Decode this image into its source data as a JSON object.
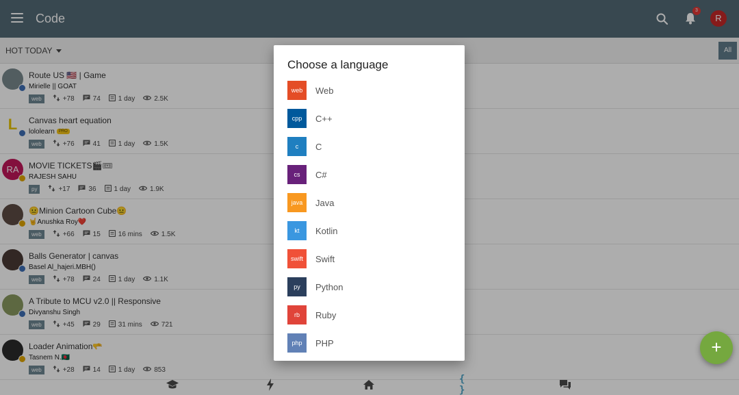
{
  "appbar": {
    "title": "Code",
    "notification_count": "3",
    "avatar_letter": "R"
  },
  "filter": {
    "sort_label": "HOT TODAY",
    "all_label": "All"
  },
  "codes": [
    {
      "title": "Route US 🇺🇸 | Game",
      "author": "Mirielle || GOAT",
      "lang": "web",
      "votes": "+78",
      "comments": "74",
      "time": "1 day",
      "views": "2.5K",
      "avatar_text": "",
      "avatar_color": "#7a8a8e",
      "level_color": "#3f6fb5",
      "pro": ""
    },
    {
      "title": "Canvas heart equation",
      "author": "lololearn",
      "lang": "web",
      "votes": "+76",
      "comments": "41",
      "time": "1 day",
      "views": "1.5K",
      "avatar_text": "L",
      "avatar_color": "#ffffff",
      "level_color": "#3f6fb5",
      "pro": "PRO"
    },
    {
      "title": "MOVIE TICKETS🎬🎟",
      "author": "RAJESH SAHU",
      "lang": "py",
      "votes": "+17",
      "comments": "36",
      "time": "1 day",
      "views": "1.9K",
      "avatar_text": "RA",
      "avatar_color": "#c2185b",
      "level_color": "#e0a500",
      "pro": ""
    },
    {
      "title": "😐Minion Cartoon Cube😐",
      "author": "🤘Anushka Roy❤️",
      "lang": "web",
      "votes": "+66",
      "comments": "15",
      "time": "16 mins",
      "views": "1.5K",
      "avatar_text": "",
      "avatar_color": "#5d4c45",
      "level_color": "#e0a500",
      "pro": ""
    },
    {
      "title": "Balls Generator | canvas",
      "author": "Basel Al_hajeri.MBH()",
      "lang": "web",
      "votes": "+78",
      "comments": "24",
      "time": "1 day",
      "views": "1.1K",
      "avatar_text": "",
      "avatar_color": "#4a3a35",
      "level_color": "#3f6fb5",
      "pro": ""
    },
    {
      "title": "A Tribute to MCU v2.0 || Responsive",
      "author": "Divyanshu Singh",
      "lang": "web",
      "votes": "+45",
      "comments": "29",
      "time": "31 mins",
      "views": "721",
      "avatar_text": "",
      "avatar_color": "#8a9a60",
      "level_color": "#3f6fb5",
      "pro": ""
    },
    {
      "title": "Loader Animation🫳",
      "author": "Tasnem N.🇧🇩",
      "lang": "web",
      "votes": "+28",
      "comments": "14",
      "time": "1 day",
      "views": "853",
      "avatar_text": "",
      "avatar_color": "#2b2b2b",
      "level_color": "#e0a500",
      "pro": ""
    }
  ],
  "dialog": {
    "title": "Choose a language",
    "languages": [
      {
        "code": "web",
        "name": "Web",
        "color": "#e44d26"
      },
      {
        "code": "cpp",
        "name": "C++",
        "color": "#00599c"
      },
      {
        "code": "c",
        "name": "C",
        "color": "#1f7fc0"
      },
      {
        "code": "cs",
        "name": "C#",
        "color": "#68217a"
      },
      {
        "code": "java",
        "name": "Java",
        "color": "#f89820"
      },
      {
        "code": "kt",
        "name": "Kotlin",
        "color": "#3a97e0"
      },
      {
        "code": "swift",
        "name": "Swift",
        "color": "#f05138"
      },
      {
        "code": "py",
        "name": "Python",
        "color": "#2b3f5c"
      },
      {
        "code": "rb",
        "name": "Ruby",
        "color": "#e0443a"
      },
      {
        "code": "php",
        "name": "PHP",
        "color": "#6181b6"
      }
    ]
  },
  "fab": {
    "label": "+"
  },
  "bottom_nav": {
    "icons": [
      "learn-icon",
      "lightning-icon",
      "home-icon",
      "code-icon",
      "discuss-icon"
    ],
    "code_label": "{ }",
    "active": "code-icon"
  },
  "colors": {
    "appbar": "#536a77",
    "accent": "#75a83f",
    "tag": "#6e8793"
  }
}
